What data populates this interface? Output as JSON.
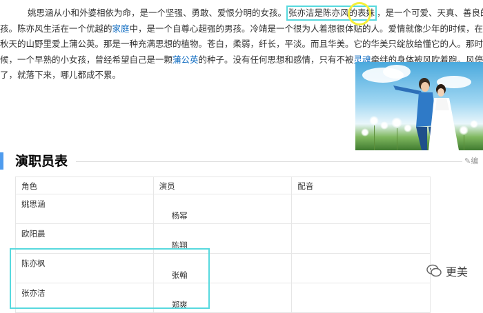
{
  "article": {
    "line1_a": "姚思涵从小和外婆相依为命，是一个坚强、勇敢、爱恨分明的女孩。",
    "line1_highlight": "张亦洁是陈亦风的表妹",
    "line1_b": "，是一个可爱、天真、善良的女",
    "line2_a": "孩。陈亦风生活在一个优越的",
    "line2_link": "家庭",
    "line2_b": "中，是一个自尊心超强的男孩。冷靖是一个很为人着想很体贴的人。爱情就像少年的时候，在",
    "line3": "秋天的山野里爱上蒲公英。那是一种充满思想的植物。苍白，柔弱，纤长，平淡。而且华美。它的华美只绽放给懂它的人。那时",
    "line4_a": "候，一个早熟的小女孩，曾经希望自己是一颗",
    "line4_link": "蒲公英",
    "line4_b": "的种子。没有任何思想和感情，只有不被",
    "line4_link2": "灵魂",
    "line4_c": "牵绊的身体被风吹着跑。风停",
    "line5": "了，就落下来，哪儿都成不累。"
  },
  "section": {
    "title": "演职员表",
    "edit_label": "编"
  },
  "cast_table": {
    "headers": [
      "角色",
      "演员",
      "配音"
    ],
    "rows": [
      {
        "role": "姚思涵",
        "actor": "杨幂",
        "voice": ""
      },
      {
        "role": "欧阳晨",
        "actor": "陈翔",
        "voice": ""
      },
      {
        "role": "陈亦枫",
        "actor": "张翰",
        "voice": ""
      },
      {
        "role": "张亦洁",
        "actor": "郑爽",
        "voice": ""
      }
    ]
  },
  "watermark": {
    "text": "更美",
    "icon": "chat-bubble-icon"
  },
  "colors": {
    "highlight_box": "#57d9de",
    "circle": "#f6ef3a",
    "link": "#136ec2",
    "section_bar": "#4f9cee"
  }
}
